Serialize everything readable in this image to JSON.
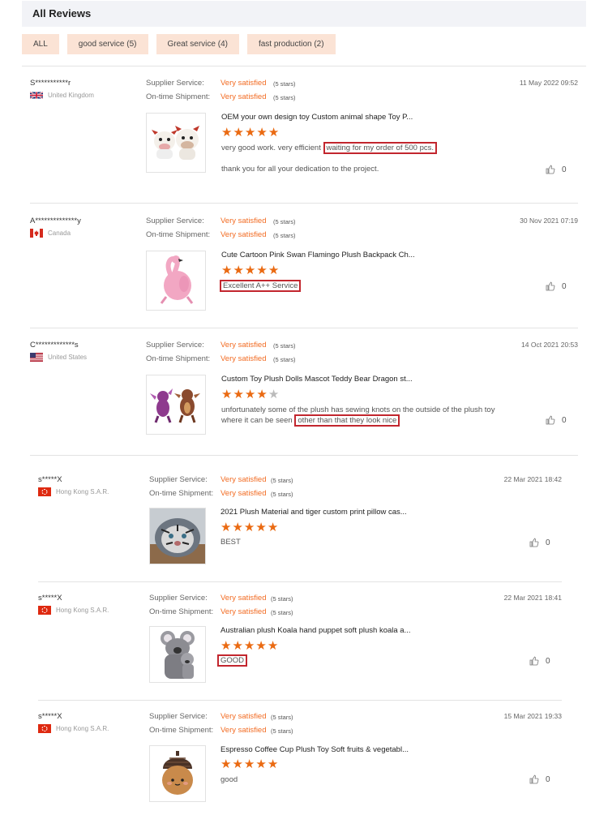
{
  "header": {
    "title": "All Reviews"
  },
  "filters": [
    {
      "label": "ALL"
    },
    {
      "label": "good service (5)"
    },
    {
      "label": "Great service (4)"
    },
    {
      "label": "fast production (2)"
    }
  ],
  "labels": {
    "supplier_service": "Supplier Service:",
    "ontime_shipment": "On-time Shipment:"
  },
  "reviews": [
    {
      "user": "S***********r",
      "country": "United Kingdom",
      "flag": "uk",
      "supplier_value": "Very satisfied",
      "supplier_stars": "(5 stars)",
      "shipment_value": "Very satisfied",
      "shipment_stars": "(5 stars)",
      "date": "11 May 2022 09:52",
      "product_title": "OEM your own design toy Custom animal shape Toy P...",
      "product_image": "cow-plush-toys",
      "rating": 5,
      "text_line1": "very good work. very efficient",
      "text_highlight": "waiting for my order of 500 pcs.",
      "text_line2": "thank you for all your dedication to the project.",
      "likes": "0"
    },
    {
      "user": "A**************y",
      "country": "Canada",
      "flag": "ca",
      "supplier_value": "Very satisfied",
      "supplier_stars": "(5 stars)",
      "shipment_value": "Very satisfied",
      "shipment_stars": "(5 stars)",
      "date": "30 Nov 2021 07:19",
      "product_title": "Cute Cartoon Pink Swan Flamingo Plush Backpack Ch...",
      "product_image": "pink-flamingo-backpack",
      "rating": 5,
      "text_highlight": "Excellent A++ Service",
      "likes": "0"
    },
    {
      "user": "C*************s",
      "country": "United States",
      "flag": "us",
      "supplier_value": "Very satisfied",
      "supplier_stars": "(5 stars)",
      "shipment_value": "Very satisfied",
      "shipment_stars": "(5 stars)",
      "date": "14 Oct 2021 20:53",
      "product_title": "Custom Toy Plush Dolls Mascot Teddy Bear Dragon st...",
      "product_image": "purple-dragon-plush",
      "rating": 4,
      "text_line1": "unfortunately some of the plush has sewing knots on the outside of the plush toy",
      "text_line2_prefix": "where it can be seen",
      "text_highlight": "other than that they look nice",
      "likes": "0"
    },
    {
      "user": "s*****X",
      "country": "Hong Kong S.A.R.",
      "flag": "hk",
      "supplier_value": "Very satisfied",
      "supplier_stars": "(5 stars)",
      "shipment_value": "Very satisfied",
      "shipment_stars": "(5 stars)",
      "date": "22 Mar 2021 18:42",
      "product_title": "2021 Plush Material and tiger custom print pillow cas...",
      "product_image": "tiger-pillow",
      "rating": 5,
      "text": "BEST",
      "likes": "0"
    },
    {
      "user": "s*****X",
      "country": "Hong Kong S.A.R.",
      "flag": "hk",
      "supplier_value": "Very satisfied",
      "supplier_stars": "(5 stars)",
      "shipment_value": "Very satisfied",
      "shipment_stars": "(5 stars)",
      "date": "22 Mar 2021 18:41",
      "product_title": "Australian plush Koala hand puppet soft plush koala a...",
      "product_image": "koala-puppet",
      "rating": 5,
      "text_highlight": "GOOD",
      "likes": "0"
    },
    {
      "user": "s*****X",
      "country": "Hong Kong S.A.R.",
      "flag": "hk",
      "supplier_value": "Very satisfied",
      "supplier_stars": "(5 stars)",
      "shipment_value": "Very satisfied",
      "shipment_stars": "(5 stars)",
      "date": "15 Mar 2021 19:33",
      "product_title": "Espresso Coffee Cup Plush Toy Soft fruits & vegetabl...",
      "product_image": "acorn-plush",
      "rating": 5,
      "text": "good",
      "likes": "0"
    }
  ],
  "icons": {
    "star": "★",
    "like": "thumbs-up-icon"
  },
  "colors": {
    "accent": "#f26b22",
    "highlight_box": "#c2262e",
    "filter_bg": "#fbe3d5"
  }
}
